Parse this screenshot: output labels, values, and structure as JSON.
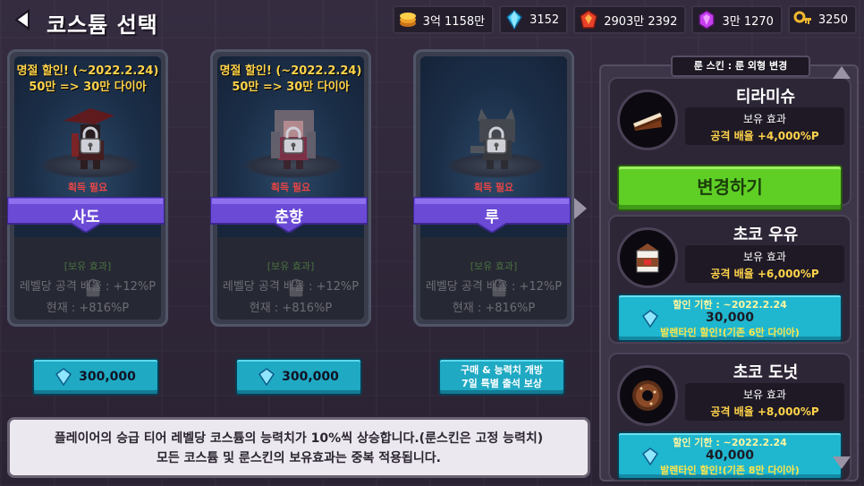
{
  "header": {
    "title": "코스튬 선택"
  },
  "currencies": [
    {
      "icon": "coin-stack-icon",
      "value": "3억 1158만"
    },
    {
      "icon": "blue-diamond-icon",
      "value": "3152"
    },
    {
      "icon": "red-gem-icon",
      "value": "2903만 2392"
    },
    {
      "icon": "purple-crystal-icon",
      "value": "3만 1270"
    },
    {
      "icon": "key-icon",
      "value": "3250"
    }
  ],
  "costumes": [
    {
      "sale_line1": "명절 할인! (~2022.2.24)",
      "sale_line2": "50만 => 30만 다이아",
      "need": "획득 필요",
      "name": "사도",
      "effect_head": "[보유 효과]",
      "effect_line1": "레벨당 공격 배율 : +12%P",
      "effect_line2": "현재 : +816%P",
      "price": "300,000"
    },
    {
      "sale_line1": "명절 할인! (~2022.2.24)",
      "sale_line2": "50만 => 30만 다이아",
      "need": "획득 필요",
      "name": "춘향",
      "effect_head": "[보유 효과]",
      "effect_line1": "레벨당 공격 배율 : +12%P",
      "effect_line2": "현재 : +816%P",
      "price": "300,000"
    },
    {
      "sale_line1": "",
      "sale_line2": "",
      "need": "획득 필요",
      "name": "루",
      "effect_head": "[보유 효과]",
      "effect_line1": "레벨당 공격 배율 : +12%P",
      "effect_line2": "현재 : +816%P",
      "button_line1": "구매 & 능력치 개방",
      "button_line2": "7일 특별 출석 보상"
    }
  ],
  "notice": {
    "line1": "플레이어의 승급 티어 레벨당 코스튬의 능력치가 10%씩 상승합니다.(룬스킨은 고정 능력치)",
    "line2": "모든 코스튬 및 룬스킨의 보유효과는 중복 적용됩니다."
  },
  "rune_panel": {
    "tab_label": "룬 스킨 : 룬 외형 변경",
    "items": [
      {
        "name": "티라미슈",
        "icon": "tiramisu-cake-icon",
        "effect_head": "보유 효과",
        "effect_value": "공격 배율 +4,000%P",
        "button": "변경하기"
      },
      {
        "name": "초코 우유",
        "icon": "chocolate-milk-carton-icon",
        "effect_head": "보유 효과",
        "effect_value": "공격 배율 +6,000%P",
        "sale_line1": "할인 기한 : ~2022.2.24",
        "price": "30,000",
        "sale_line3": "발렌타인 할인!(기존 6만 다이아)"
      },
      {
        "name": "초코 도넛",
        "icon": "chocolate-donut-icon",
        "effect_head": "보유 효과",
        "effect_value": "공격 배율 +8,000%P",
        "sale_line1": "할인 기한 : ~2022.2.24",
        "price": "40,000",
        "sale_line3": "발렌타인 할인!(기존 8만 다이아)"
      }
    ]
  }
}
